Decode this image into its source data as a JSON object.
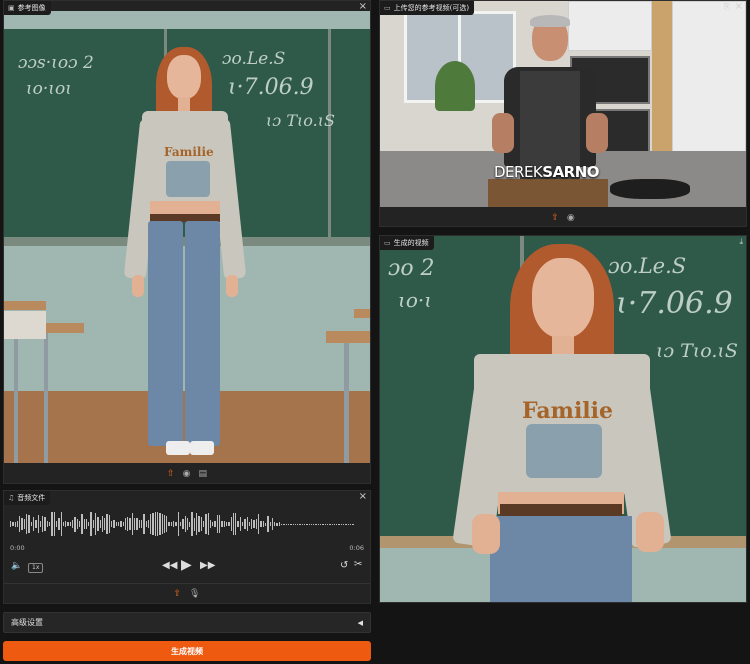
{
  "reference_image": {
    "title": "参考图像",
    "chalk_lines": [
      "ɔɔs·ɩoɔ 2",
      "ɩo·ɩoɩ",
      "ɔo.Le.S",
      "ɩ·7.06.9",
      "ɩɔ Tɩo.ɩS"
    ],
    "shirt_text": "Familie"
  },
  "reference_video": {
    "title": "上传您的参考视频(可选)",
    "brand_left": "DEREK",
    "brand_right": "SARNO"
  },
  "generated_video": {
    "title": "生成的视频",
    "chalk_lines": [
      "ɔo 2",
      "ɩo·ɩ",
      "ɔo.Le.S",
      "ɩ·7.06.9",
      "ɩɔ Tɩo.ɩS"
    ],
    "shirt_text": "Familie"
  },
  "audio": {
    "title": "音频文件",
    "time_current": "0:00",
    "time_total": "0:06",
    "speed": "1x"
  },
  "advanced_settings": {
    "label": "高级设置",
    "arrow": "◀"
  },
  "generate_button": {
    "label": "生成视频"
  },
  "colors": {
    "accent": "#ee5a0f",
    "panel": "#232323",
    "background": "#141414"
  }
}
